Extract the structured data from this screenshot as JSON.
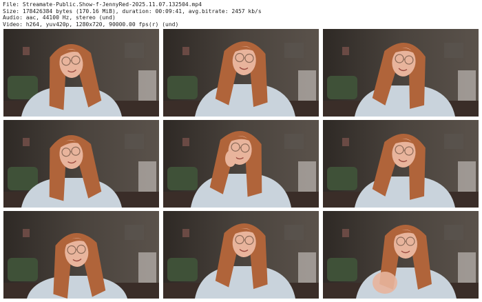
{
  "header": {
    "file_line": "File: Streamate-Public.Show-f-JennyRed-2025.11.07.132504.mp4",
    "size_line": "Size: 178426384 bytes (170.16 MiB), duration: 00:09:41, avg.bitrate: 2457 kb/s",
    "audio_line": "Audio: aac, 44100 Hz, stereo (und)",
    "video_line": "Video: h264, yuv420p, 1280x720, 90000.00 fps(r) (und)"
  },
  "thumbnails": [
    {
      "pose": "smile-left"
    },
    {
      "pose": "laugh-center"
    },
    {
      "pose": "smile-right"
    },
    {
      "pose": "smile-left"
    },
    {
      "pose": "hand-cheek"
    },
    {
      "pose": "smile-right"
    },
    {
      "pose": "look-down"
    },
    {
      "pose": "laugh-center"
    },
    {
      "pose": "hand-wave"
    }
  ],
  "colors": {
    "background": "#ffffff",
    "wall": "#4a433d",
    "hair": "#b0643a",
    "sweater": "#c9d3dc",
    "skin": "#e8b49c"
  }
}
